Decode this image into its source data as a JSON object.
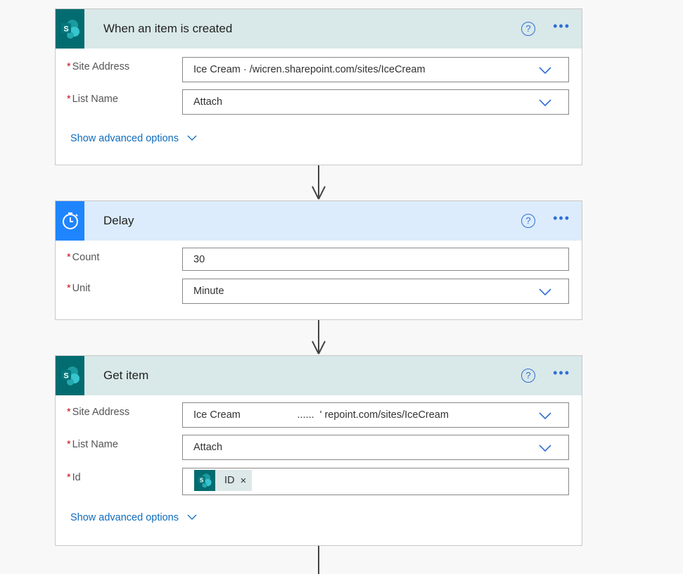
{
  "cards": [
    {
      "title": "When an item is created",
      "icon": "sharepoint-icon",
      "fields": [
        {
          "label": "Site Address",
          "value": "Ice Cream   ·      /wicren.sharepoint.com/sites/IceCream"
        },
        {
          "label": "List Name",
          "value": "Attach"
        }
      ],
      "advanced": "Show advanced options"
    },
    {
      "title": "Delay",
      "icon": "timer-icon",
      "fields": [
        {
          "label": "Count",
          "value": "30"
        },
        {
          "label": "Unit",
          "value": "Minute"
        }
      ]
    },
    {
      "title": "Get item",
      "icon": "sharepoint-icon",
      "fields": [
        {
          "label": "Site Address",
          "value": "Ice Cream                    ......  ' repoint.com/sites/IceCream"
        },
        {
          "label": "List Name",
          "value": "Attach"
        },
        {
          "label": "Id",
          "token": "ID",
          "token_remove": "×"
        }
      ],
      "advanced": "Show advanced options"
    }
  ],
  "required_mark": "*",
  "help_glyph": "?",
  "more_glyph": "•••",
  "colors": {
    "sharepoint": "#036c70",
    "delay": "#1f85ff",
    "link": "#0f6cbd",
    "required": "#c50f1f"
  }
}
